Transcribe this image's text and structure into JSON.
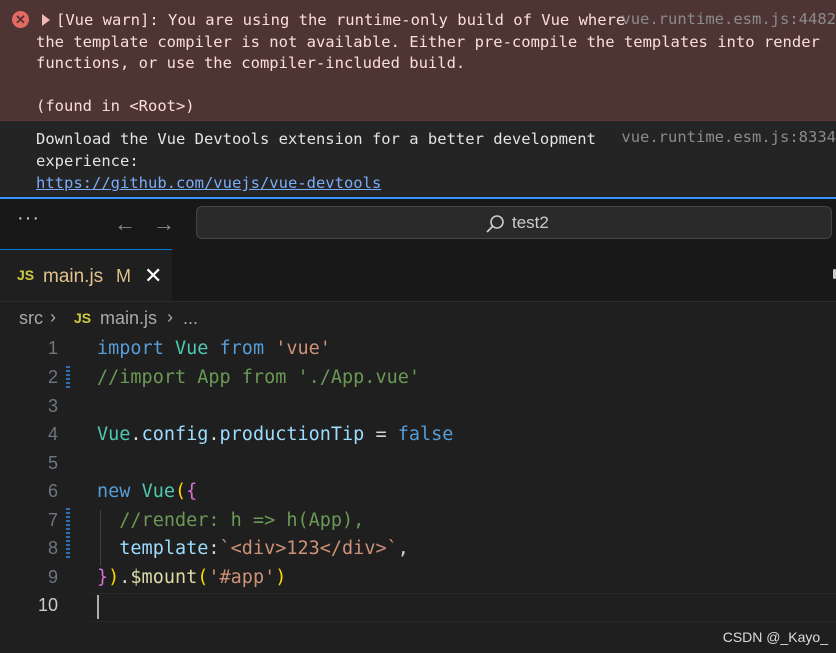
{
  "console": {
    "warning": {
      "lines": [
        "[Vue warn]: You are using the runtime-only build of Vue where",
        "the template compiler is not available. Either pre-compile the templates into render",
        "functions, or use the compiler-included build.",
        "",
        "(found in <Root>)"
      ],
      "source": "vue.runtime.esm.js:4482"
    },
    "info": {
      "lines": [
        "Download the Vue Devtools extension for a better development",
        "experience:"
      ],
      "link": "https://github.com/vuejs/vue-devtools",
      "source": "vue.runtime.esm.js:8334"
    }
  },
  "titlebar": {
    "menu_icon": "ellipsis",
    "back_icon": "arrow-left",
    "forward_icon": "arrow-right",
    "search_text": "test2"
  },
  "tab": {
    "icon_text": "JS",
    "name": "main.js",
    "status": "M"
  },
  "breadcrumb": {
    "folder": "src",
    "icon_text": "JS",
    "file": "main.js",
    "more": "..."
  },
  "editor": {
    "line_numbers": [
      "1",
      "2",
      "3",
      "4",
      "5",
      "6",
      "7",
      "8",
      "9",
      "10"
    ],
    "active_line": "10"
  },
  "watermark": "CSDN @_Kayo_",
  "colors": {
    "accent": "#3794ff",
    "warn_bg": "#4e3534",
    "editor_bg": "#1f1f1f",
    "keyword": "#569cd6",
    "string": "#ce9178",
    "comment": "#6a9955"
  }
}
